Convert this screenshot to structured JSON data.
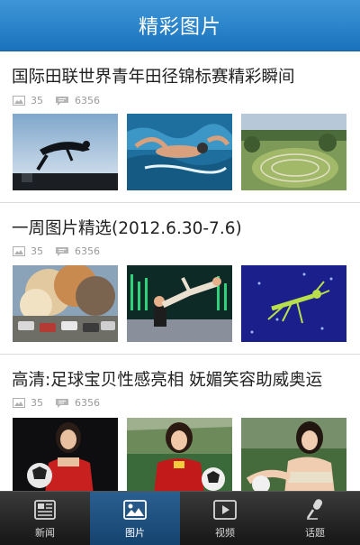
{
  "header": {
    "title": "精彩图片"
  },
  "articles": [
    {
      "title": "国际田联世界青年田径锦标赛精彩瞬间",
      "photo_count": "35",
      "comment_count": "6356",
      "thumbs": [
        "high-jumper-silhouette-photo",
        "swimmer-photo",
        "stadium-aerial-photo"
      ]
    },
    {
      "title": "一周图片精选(2012.6.30-7.6)",
      "photo_count": "35",
      "comment_count": "6356",
      "thumbs": [
        "smoke-cloud-cars-photo",
        "figure-skating-pair-photo",
        "mantis-photo"
      ]
    },
    {
      "title": "高清:足球宝贝性感亮相 妩媚笑容助威奥运",
      "photo_count": "35",
      "comment_count": "6356",
      "thumbs": [
        "football-model-photo-1",
        "football-model-photo-2",
        "football-model-photo-3"
      ]
    }
  ],
  "tabbar": {
    "tabs": [
      {
        "label": "新闻",
        "icon": "news-icon",
        "active": false
      },
      {
        "label": "图片",
        "icon": "picture-icon",
        "active": true
      },
      {
        "label": "视频",
        "icon": "video-icon",
        "active": false
      },
      {
        "label": "话题",
        "icon": "microphone-icon",
        "active": false
      }
    ]
  },
  "colors": {
    "header": "#1a72bd",
    "tab_active": "#1f5384",
    "tabbar": "#222222"
  }
}
